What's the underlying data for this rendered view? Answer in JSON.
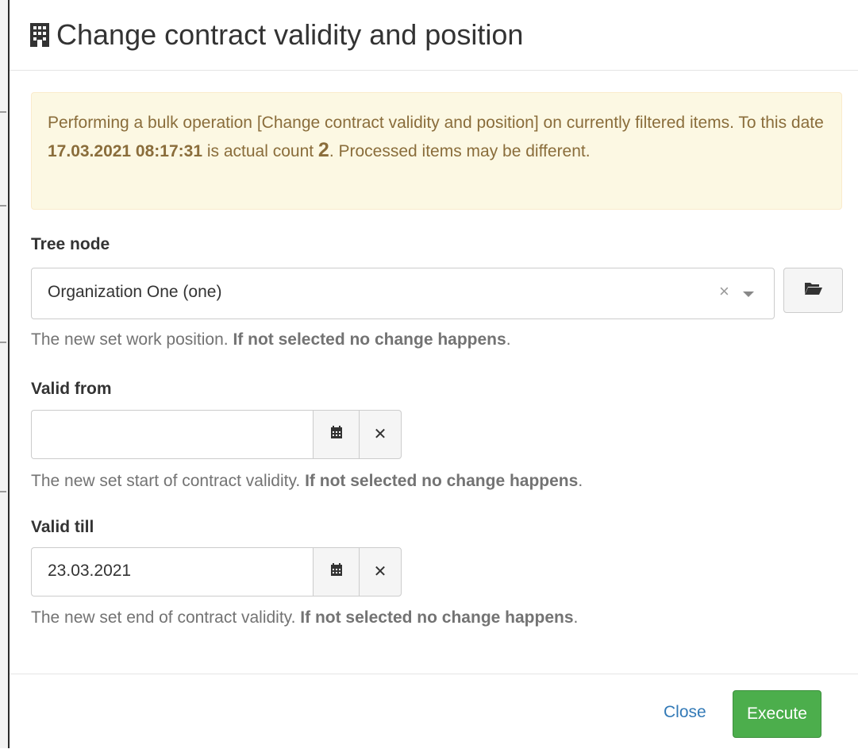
{
  "modal": {
    "title": "Change contract validity and position",
    "title_icon": "building-icon"
  },
  "alert": {
    "text_before_date": "Performing a bulk operation [Change contract validity and position] on currently filtered items. To this date ",
    "date": "17.03.2021 08:17:31",
    "text_before_count": " is actual count ",
    "count": "2",
    "text_after_count": ". Processed items may be different."
  },
  "tree_node": {
    "label": "Tree node",
    "value": "Organization One (one)",
    "clear_icon": "×",
    "help_text": "The new set work position. ",
    "help_strong": "If not selected no change happens",
    "help_end": "."
  },
  "valid_from": {
    "label": "Valid from",
    "value": "",
    "help_text": "The new set start of contract validity. ",
    "help_strong": "If not selected no change happens",
    "help_end": "."
  },
  "valid_till": {
    "label": "Valid till",
    "value": "23.03.2021",
    "help_text": "The new set end of contract validity. ",
    "help_strong": "If not selected no change happens",
    "help_end": "."
  },
  "icons": {
    "calendar": "calendar-icon",
    "clear": "close-icon",
    "folder": "folder-open-icon",
    "caret": "chevron-down-icon",
    "clear_glyph": "✕"
  },
  "footer": {
    "close_label": "Close",
    "execute_label": "Execute"
  },
  "colors": {
    "alert_bg": "#fcf8e3",
    "alert_text": "#8a6d3b",
    "link": "#337ab7",
    "success": "#4cae4c"
  }
}
